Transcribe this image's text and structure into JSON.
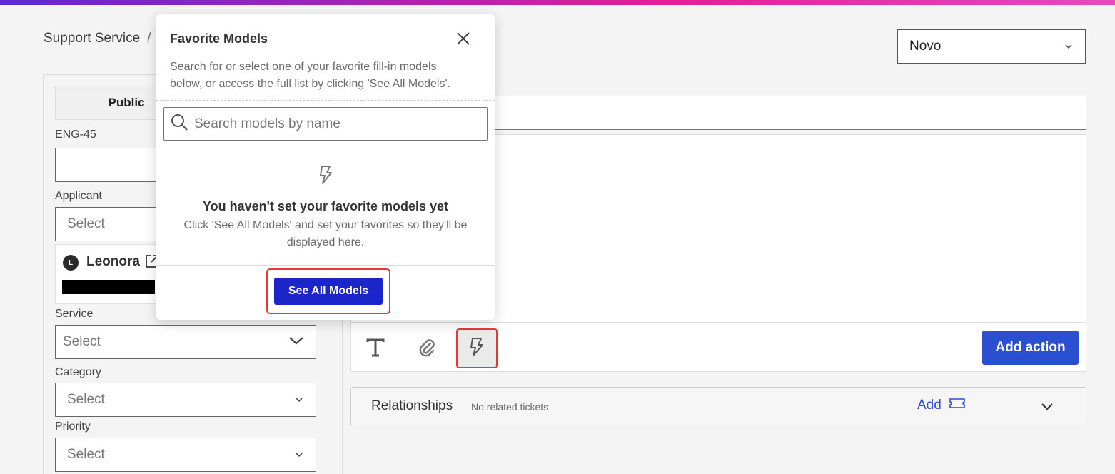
{
  "breadcrumb": {
    "root": "Support Service",
    "separator": "/"
  },
  "status": {
    "value": "Novo",
    "icon": "chevron-down-icon"
  },
  "left": {
    "tab_public": "Public",
    "ticket_id": "ENG-45",
    "applicant_label": "Applicant",
    "applicant_placeholder": "Select",
    "person": {
      "initial": "L",
      "name": "Leonora"
    },
    "service_label": "Service",
    "service_placeholder": "Select",
    "category_label": "Category",
    "category_placeholder": "Select",
    "priority_label": "Priority",
    "priority_placeholder": "Select"
  },
  "toolbar": {
    "add_action": "Add action",
    "icons": [
      "text-format-icon",
      "paperclip-icon",
      "lightning-icon"
    ]
  },
  "relationships": {
    "title": "Relationships",
    "subtitle": "No related tickets",
    "add_label": "Add"
  },
  "popover": {
    "title": "Favorite Models",
    "description": "Search for or select one of your favorite fill-in models below, or access the full list by clicking 'See All Models'.",
    "search_placeholder": "Search models by name",
    "empty_title": "You haven't set your favorite models yet",
    "empty_description": "Click 'See All Models' and set your favorites so they'll be displayed here.",
    "see_all_button": "See All Models"
  },
  "colors": {
    "accent": "#2a4fd0",
    "see_all": "#1c25c9",
    "highlight": "#e53935"
  }
}
